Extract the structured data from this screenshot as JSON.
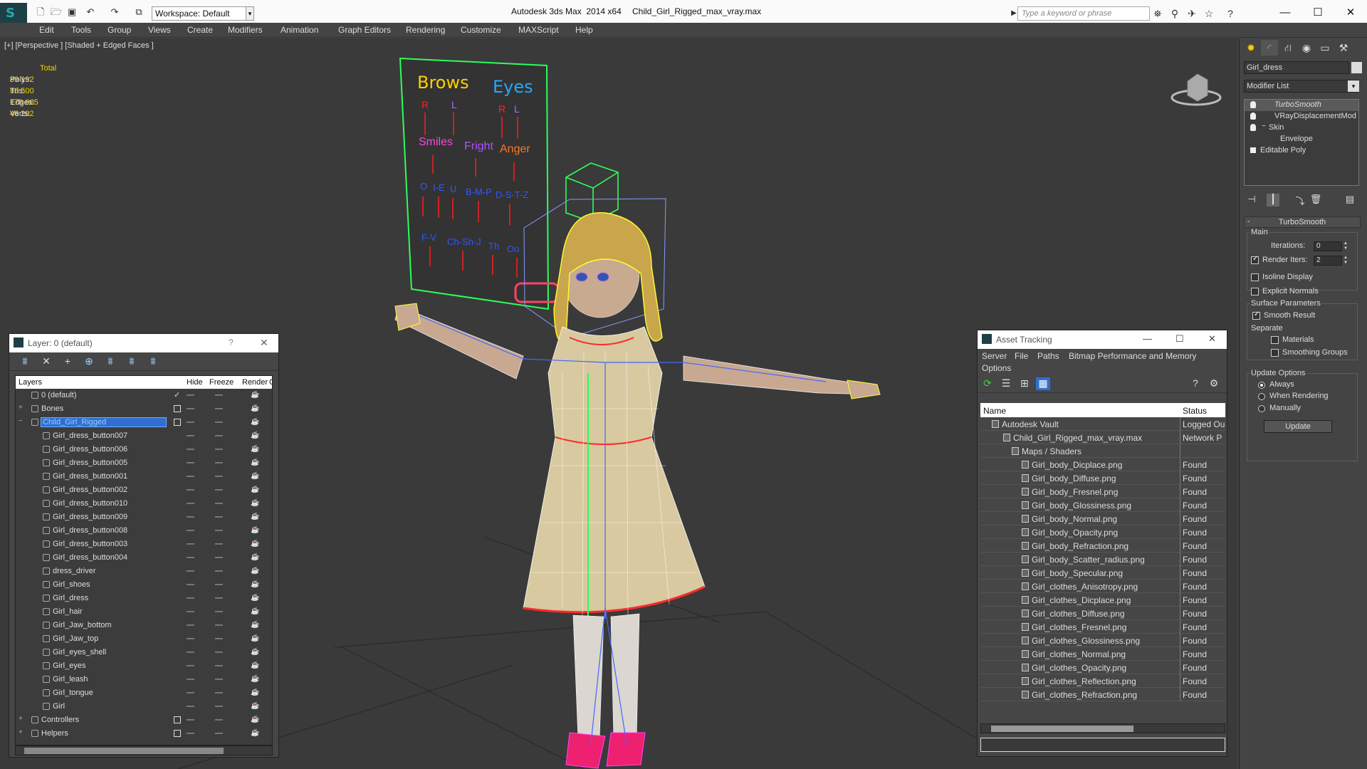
{
  "titlebar": {
    "app_title": "Autodesk 3ds Max  2014 x64",
    "file_title": "Child_Girl_Rigged_max_vray.max",
    "workspace": "Workspace: Default",
    "search_placeholder": "Type a keyword or phrase",
    "window_buttons": [
      "—",
      "☐",
      "✕"
    ]
  },
  "menubar": [
    "Edit",
    "Tools",
    "Group",
    "Views",
    "Create",
    "Modifiers",
    "Animation",
    "Graph Editors",
    "Rendering",
    "Customize",
    "MAXScript",
    "Help"
  ],
  "viewport": {
    "label": "[+] [Perspective ] [Shaded + Edged Faces ]",
    "stats": {
      "header": "Total",
      "rows": [
        {
          "label": "Polys:",
          "value": "89 192"
        },
        {
          "label": "Tris:",
          "value": "89 500"
        },
        {
          "label": "Edges:",
          "value": "178 665"
        },
        {
          "label": "Verts:",
          "value": "46 292"
        }
      ]
    },
    "rig_board": {
      "brows": "Brows",
      "eyes": "Eyes",
      "r1": "R",
      "l1": "L",
      "r2": "R",
      "l2": "L",
      "smiles": "Smiles",
      "fright": "Fright",
      "anger": "Anger",
      "o": "O",
      "ie": "I-E",
      "u": "U",
      "bmp": "B-M-P",
      "dstz": "D-S-T-Z",
      "fv": "F-V",
      "chsh": "Ch-Sh-J",
      "th": "Th",
      "oo": "Oo"
    }
  },
  "layer_panel": {
    "title": "Layer: 0 (default)",
    "help": "?",
    "close": "✕",
    "columns": [
      "Layers",
      "Hide",
      "Freeze",
      "Render",
      "C"
    ],
    "rows": [
      {
        "name": "0 (default)",
        "level": 0,
        "type": "layer",
        "check": "✓"
      },
      {
        "name": "Bones",
        "level": 0,
        "type": "layer",
        "expand": "+",
        "box": true
      },
      {
        "name": "Child_Girl_Rigged",
        "level": 0,
        "type": "layer",
        "expand": "−",
        "box": true,
        "selected": true
      },
      {
        "name": "Girl_dress_button007",
        "level": 1,
        "type": "object"
      },
      {
        "name": "Girl_dress_button006",
        "level": 1,
        "type": "object"
      },
      {
        "name": "Girl_dress_button005",
        "level": 1,
        "type": "object"
      },
      {
        "name": "Girl_dress_button001",
        "level": 1,
        "type": "object"
      },
      {
        "name": "Girl_dress_button002",
        "level": 1,
        "type": "object"
      },
      {
        "name": "Girl_dress_button010",
        "level": 1,
        "type": "object"
      },
      {
        "name": "Girl_dress_button009",
        "level": 1,
        "type": "object"
      },
      {
        "name": "Girl_dress_button008",
        "level": 1,
        "type": "object"
      },
      {
        "name": "Girl_dress_button003",
        "level": 1,
        "type": "object"
      },
      {
        "name": "Girl_dress_button004",
        "level": 1,
        "type": "object"
      },
      {
        "name": "dress_driver",
        "level": 1,
        "type": "object"
      },
      {
        "name": "Girl_shoes",
        "level": 1,
        "type": "object"
      },
      {
        "name": "Girl_dress",
        "level": 1,
        "type": "object"
      },
      {
        "name": "Girl_hair",
        "level": 1,
        "type": "object"
      },
      {
        "name": "Girl_Jaw_bottom",
        "level": 1,
        "type": "object"
      },
      {
        "name": "Girl_Jaw_top",
        "level": 1,
        "type": "object"
      },
      {
        "name": "Girl_eyes_shell",
        "level": 1,
        "type": "object"
      },
      {
        "name": "Girl_eyes",
        "level": 1,
        "type": "object"
      },
      {
        "name": "Girl_leash",
        "level": 1,
        "type": "object"
      },
      {
        "name": "Girl_tongue",
        "level": 1,
        "type": "object"
      },
      {
        "name": "Girl",
        "level": 1,
        "type": "object"
      },
      {
        "name": "Controllers",
        "level": 0,
        "type": "layer",
        "expand": "+",
        "box": true
      },
      {
        "name": "Helpers",
        "level": 0,
        "type": "layer",
        "expand": "+",
        "box": true
      }
    ]
  },
  "asset_panel": {
    "title": "Asset Tracking",
    "window_buttons": [
      "—",
      "☐",
      "✕"
    ],
    "menu": [
      "Server",
      "File",
      "Paths",
      "Bitmap Performance and Memory"
    ],
    "menu2": "Options",
    "columns": [
      "Name",
      "Status"
    ],
    "rows": [
      {
        "name": "Autodesk Vault",
        "status": "Logged Ou",
        "indent": 30
      },
      {
        "name": "Child_Girl_Rigged_max_vray.max",
        "status": "Network P",
        "indent": 46
      },
      {
        "name": "Maps / Shaders",
        "status": "",
        "indent": 58
      },
      {
        "name": "Girl_body_Dicplace.png",
        "status": "Found",
        "indent": 72
      },
      {
        "name": "Girl_body_Diffuse.png",
        "status": "Found",
        "indent": 72
      },
      {
        "name": "Girl_body_Fresnel.png",
        "status": "Found",
        "indent": 72
      },
      {
        "name": "Girl_body_Glossiness.png",
        "status": "Found",
        "indent": 72
      },
      {
        "name": "Girl_body_Normal.png",
        "status": "Found",
        "indent": 72
      },
      {
        "name": "Girl_body_Opacity.png",
        "status": "Found",
        "indent": 72
      },
      {
        "name": "Girl_body_Refraction.png",
        "status": "Found",
        "indent": 72
      },
      {
        "name": "Girl_body_Scatter_radius.png",
        "status": "Found",
        "indent": 72
      },
      {
        "name": "Girl_body_Specular.png",
        "status": "Found",
        "indent": 72
      },
      {
        "name": "Girl_clothes_Anisotropy.png",
        "status": "Found",
        "indent": 72
      },
      {
        "name": "Girl_clothes_Dicplace.png",
        "status": "Found",
        "indent": 72
      },
      {
        "name": "Girl_clothes_Diffuse.png",
        "status": "Found",
        "indent": 72
      },
      {
        "name": "Girl_clothes_Fresnel.png",
        "status": "Found",
        "indent": 72
      },
      {
        "name": "Girl_clothes_Glossiness.png",
        "status": "Found",
        "indent": 72
      },
      {
        "name": "Girl_clothes_Normal.png",
        "status": "Found",
        "indent": 72
      },
      {
        "name": "Girl_clothes_Opacity.png",
        "status": "Found",
        "indent": 72
      },
      {
        "name": "Girl_clothes_Reflection.png",
        "status": "Found",
        "indent": 72
      },
      {
        "name": "Girl_clothes_Refraction.png",
        "status": "Found",
        "indent": 72
      }
    ]
  },
  "command_panel": {
    "object_name": "Girl_dress",
    "modifier_list": "Modifier List",
    "stack": [
      {
        "name": "TurboSmooth",
        "italic": true,
        "bulb": true
      },
      {
        "name": "VRayDisplacementMod",
        "bulb": true
      },
      {
        "name": "Skin",
        "bulb": true,
        "expand": "−"
      },
      {
        "name": "Envelope",
        "sub": true
      },
      {
        "name": "Editable Poly",
        "base": true
      }
    ],
    "turbosmooth": {
      "title": "TurboSmooth",
      "main": "Main",
      "iterations_label": "Iterations:",
      "iterations": "0",
      "render_iters_label": "Render Iters:",
      "render_iters": "2",
      "render_iters_checked": true,
      "isoline": "Isoline Display",
      "explicit_normals": "Explicit Normals",
      "surface_params": "Surface Parameters",
      "smooth_result": "Smooth Result",
      "separate": "Separate",
      "materials": "Materials",
      "smoothing_groups": "Smoothing Groups",
      "update_options": "Update Options",
      "always": "Always",
      "when_rendering": "When Rendering",
      "manually": "Manually",
      "update": "Update"
    }
  },
  "colors": {
    "viewport_bg": "#3a3a3a",
    "stats_text": "#f0d000",
    "selection": "#2f6fcf",
    "wire_green": "#2cff5a",
    "wire_yellow": "#ffff30",
    "wire_blue": "#4466ff"
  }
}
